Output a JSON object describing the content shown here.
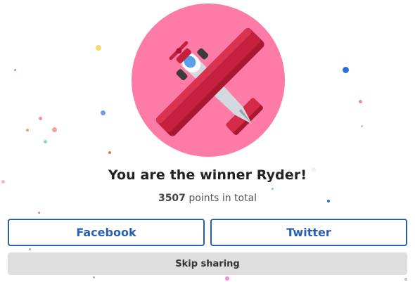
{
  "winner": {
    "title": "You are the winner Ryder!",
    "points": "3507",
    "points_suffix": " points in total"
  },
  "share": {
    "facebook_label": "Facebook",
    "twitter_label": "Twitter",
    "skip_label": "Skip sharing"
  },
  "badge": {
    "icon": "airplane-icon",
    "background_color": "#ff7ba7",
    "plane_color": "#c5213e",
    "fuselage_color": "#d4d9e0"
  },
  "colors": {
    "accent": "#2a5fb6",
    "skip_background": "#dedede"
  }
}
